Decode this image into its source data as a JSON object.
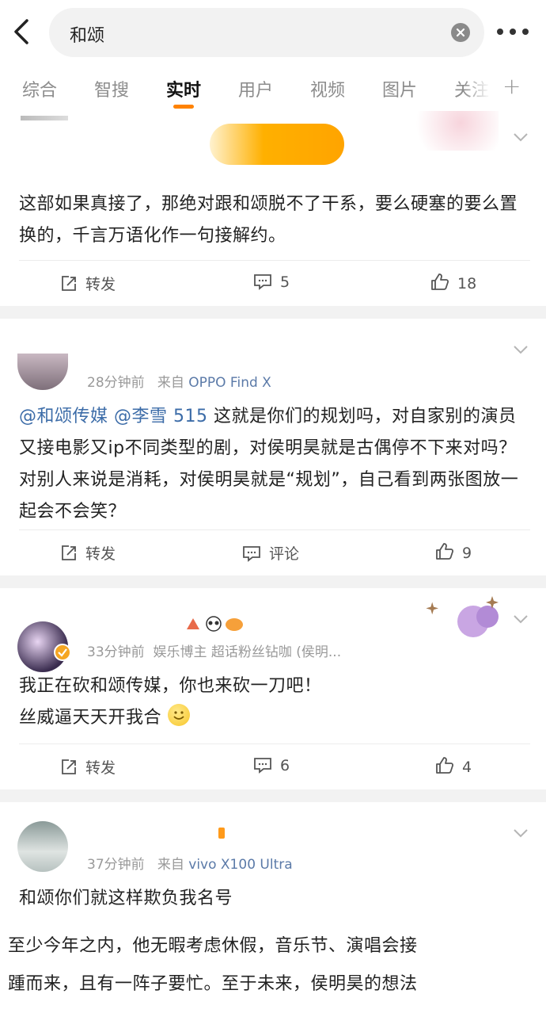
{
  "search": {
    "query": "和颂"
  },
  "tabs": [
    {
      "label": "综合"
    },
    {
      "label": "智搜"
    },
    {
      "label": "实时"
    },
    {
      "label": "用户"
    },
    {
      "label": "视频"
    },
    {
      "label": "图片"
    },
    {
      "label": "关注"
    }
  ],
  "colors": {
    "accent": "#ff8200",
    "link": "#3c6ca8",
    "separator": "#f2f2f2"
  },
  "posts": [
    {
      "text": "这部如果真接了，那绝对跟和颂脱不了干系，要么硬塞的要么置换的，千言万语化作一句接解约。",
      "repost_label": "转发",
      "comments": "5",
      "likes": "18"
    },
    {
      "time": "28分钟前",
      "source": "来自",
      "device": "OPPO Find X",
      "mention1": "@和颂传媒",
      "mention2": "@李雪 515",
      "text": " 这就是你们的规划吗，对自家别的演员又接电影又ip不同类型的剧，对侯明昊就是古偶停不下来对吗？对别人来说是消耗，对侯明昊就是“规划”，自己看到两张图放一起会不会笑？",
      "repost_label": "转发",
      "comments": "评论",
      "likes": "9"
    },
    {
      "time": "33分钟前",
      "source": "娱乐博主 超话粉丝钻咖 (侯明...",
      "line1": "我正在砍和颂传媒，你也来砍一刀吧！",
      "line2": "丝威逼天天开我合",
      "repost_label": "转发",
      "comments": "6",
      "likes": "4"
    },
    {
      "time": "37分钟前",
      "source": "来自",
      "device": "vivo X100 Ultra",
      "line1": "和颂你们就这样欺负我名号",
      "line2": "至少今年之内，他无暇考虑休假，音乐节、演唱会接",
      "line3": "踵而来，且有一阵子要忙。至于未来，侯明昊的想法"
    }
  ]
}
